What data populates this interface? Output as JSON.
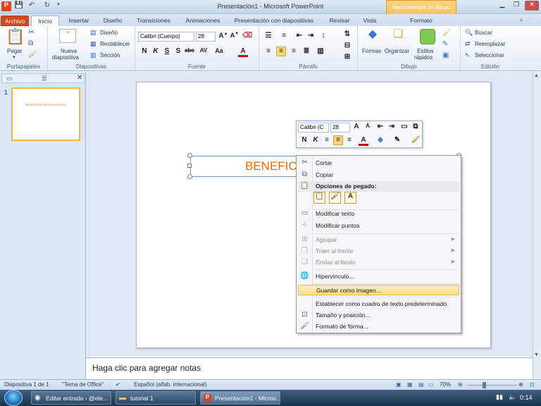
{
  "window": {
    "title": "Presentación1 - Microsoft PowerPoint",
    "contextual_band": "Herramientas de dibujo"
  },
  "tabs": [
    "Archivo",
    "Inicio",
    "Insertar",
    "Diseño",
    "Transiciones",
    "Animaciones",
    "Presentación con diapositivas",
    "Revisar",
    "Vista",
    "Formato"
  ],
  "ribbon": {
    "clipboard": {
      "paste": "Pegar",
      "group": "Portapapeles"
    },
    "slides": {
      "new_slide_1": "Nueva",
      "new_slide_2": "diapositiva",
      "layout": "Diseño",
      "reset": "Restablecer",
      "section": "Sección",
      "group": "Diapositivas"
    },
    "font": {
      "font_name": "Calibri (Cuerpo)",
      "font_size": "28",
      "group": "Fuente"
    },
    "paragraph": {
      "group": "Párrafo"
    },
    "drawing": {
      "shapes": "Formas",
      "arrange": "Organizar",
      "quick_styles_1": "Estilos",
      "quick_styles_2": "rápidos",
      "group": "Dibujo"
    },
    "editing": {
      "find": "Buscar",
      "replace": "Reemplazar",
      "select": "Seleccionar",
      "group": "Edición"
    }
  },
  "slide_pane": {
    "number": "1",
    "thumb_text": "BENEFICIOS DE LA HISTORIA"
  },
  "slide": {
    "title_text": "BENEFICI"
  },
  "mini_toolbar": {
    "font": "Calibri (C",
    "size": "28"
  },
  "context_menu": {
    "items": [
      "Cortar",
      "Copiar",
      "Opciones de pegado:",
      "Modificar texto",
      "Modificar puntos",
      "Agrupar",
      "Traer al frente",
      "Enviar al fondo",
      "Hipervínculo...",
      "Guardar como imagen...",
      "Establecer como cuadro de texto predeterminado",
      "Tamaño y posición...",
      "Formato de forma..."
    ]
  },
  "notes": {
    "placeholder": "Haga clic para agregar notas"
  },
  "status": {
    "slide": "Diapositiva 1 de 1",
    "theme": "\"Tema de Office\"",
    "language": "Español (alfab. internacional)",
    "zoom": "70%"
  },
  "taskbar": {
    "items": [
      "Editar entrada ‹ @ele...",
      "tutorial 1",
      "Presentación1 - Micros..."
    ],
    "clock": "0:14"
  },
  "colors": {
    "accent_orange": "#e36c0a",
    "file_tab": "#d2481f",
    "highlight": "#fbdc87"
  }
}
